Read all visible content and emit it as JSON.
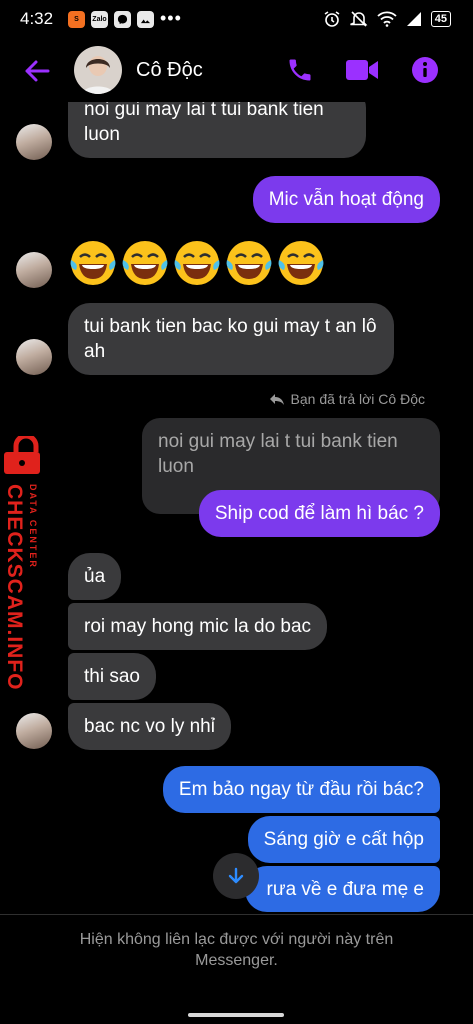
{
  "status_bar": {
    "time": "4:32",
    "app_icons": [
      "shopee-icon",
      "zalo-icon",
      "messenger-icon",
      "gallery-icon"
    ],
    "zalo_label": "Zalo",
    "dots": "•••",
    "battery": "45"
  },
  "header": {
    "contact_name": "Cô Độc",
    "accent_color": "#9b30ff"
  },
  "messages": [
    {
      "side": "in",
      "text": "noi gui may lai t tui bank tien luon"
    },
    {
      "side": "out",
      "text": "Mic vẫn hoạt động"
    },
    {
      "side": "in",
      "text": "😂😂😂😂😂",
      "type": "emoji",
      "count": 5
    },
    {
      "side": "in",
      "text": "tui bank tien bac ko gui may t an lô ah"
    },
    {
      "side": "out",
      "text": "noi gui may lai t tui bank tien luon",
      "type": "reply-preview"
    },
    {
      "side": "out",
      "text": "Ship cod để làm hì bác ?"
    },
    {
      "side": "in",
      "text": "ủa"
    },
    {
      "side": "in",
      "text": "roi may hong mic la do bac"
    },
    {
      "side": "in",
      "text": "thi sao"
    },
    {
      "side": "in",
      "text": "bac nc vo ly nhỉ"
    },
    {
      "side": "out",
      "text": "Em bảo ngay từ đầu rồi bác?"
    },
    {
      "side": "out",
      "text": "Sáng giờ e cất hộp"
    },
    {
      "side": "out",
      "text": "rưa về e đưa mẹ e"
    }
  ],
  "reply_note": "Bạn đã trả lời Cô Độc",
  "watermark": {
    "main": "CHECKSCAM.INFO",
    "sub": "DATA CENTER"
  },
  "footer": {
    "text": "Hiện không liên lạc được với người này trên Messenger."
  },
  "colors": {
    "outgoing_purple": "#7c3aed",
    "outgoing_blue": "#2d6be4",
    "incoming": "#3a3a3c",
    "watermark_red": "#e0221c"
  }
}
